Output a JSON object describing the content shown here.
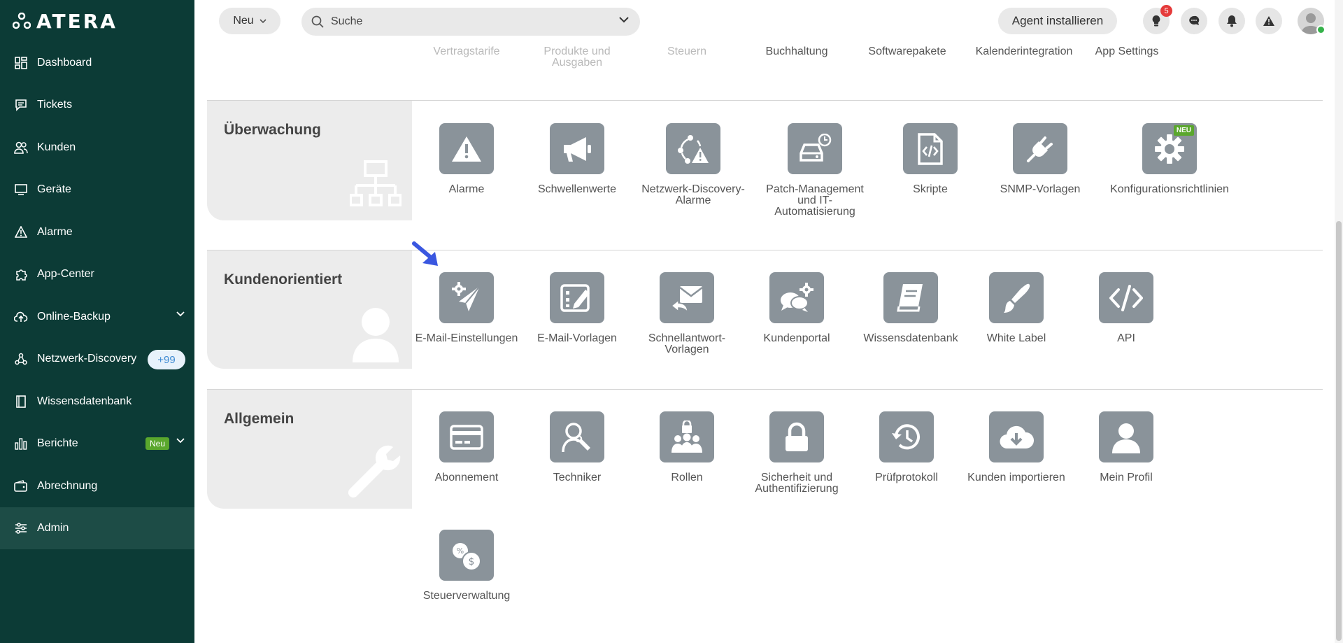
{
  "brand": {
    "logo_text": "ATERA"
  },
  "sidebar": {
    "items": [
      {
        "label": "Dashboard",
        "icon": "dashboard-icon"
      },
      {
        "label": "Tickets",
        "icon": "ticket-icon"
      },
      {
        "label": "Kunden",
        "icon": "users-icon"
      },
      {
        "label": "Geräte",
        "icon": "monitor-icon"
      },
      {
        "label": "Alarme",
        "icon": "warning-icon"
      },
      {
        "label": "App-Center",
        "icon": "puzzle-icon"
      },
      {
        "label": "Online-Backup",
        "icon": "cloud-upload-icon"
      },
      {
        "label": "Netzwerk-Discovery",
        "icon": "network-icon",
        "badge": "+99"
      },
      {
        "label": "Wissensdatenbank",
        "icon": "book-icon"
      },
      {
        "label": "Berichte",
        "icon": "bar-chart-icon",
        "badge": "Neu"
      },
      {
        "label": "Abrechnung",
        "icon": "wallet-icon"
      },
      {
        "label": "Admin",
        "icon": "sliders-icon",
        "active": true
      }
    ]
  },
  "topbar": {
    "new_button": "Neu",
    "search_placeholder": "Suche",
    "agent_button": "Agent installieren",
    "notification_count": "5"
  },
  "top_row": [
    {
      "label": "Vertragstarife",
      "faded": true
    },
    {
      "label": "Produkte und Ausgaben",
      "faded": true
    },
    {
      "label": "Steuern",
      "faded": true
    },
    {
      "label": "Buchhaltung",
      "faded": false
    },
    {
      "label": "Softwarepakete",
      "faded": false
    },
    {
      "label": "Kalenderintegration",
      "faded": false
    },
    {
      "label": "App Settings",
      "faded": false
    }
  ],
  "sections": {
    "monitoring": {
      "title": "Überwachung",
      "tiles": [
        {
          "label": "Alarme",
          "icon": "warning-icon"
        },
        {
          "label": "Schwellenwerte",
          "icon": "megaphone-icon"
        },
        {
          "label": "Netzwerk-Discovery-Alarme",
          "icon": "network-alert-icon"
        },
        {
          "label": "Patch-Management und IT-Automatisierung",
          "icon": "patch-clock-icon"
        },
        {
          "label": "Skripte",
          "icon": "script-file-icon"
        },
        {
          "label": "SNMP-Vorlagen",
          "icon": "plug-icon"
        },
        {
          "label": "Konfigurationsrichtlinien",
          "icon": "gear-icon",
          "tag": "NEU"
        }
      ]
    },
    "customer": {
      "title": "Kundenorientiert",
      "tiles": [
        {
          "label": "E-Mail-Einstellungen",
          "icon": "send-gear-icon"
        },
        {
          "label": "E-Mail-Vorlagen",
          "icon": "template-edit-icon"
        },
        {
          "label": "Schnellantwort-Vorlagen",
          "icon": "reply-mail-icon"
        },
        {
          "label": "Kundenportal",
          "icon": "chat-gear-icon"
        },
        {
          "label": "Wissensdatenbank",
          "icon": "book-icon"
        },
        {
          "label": "White Label",
          "icon": "brush-icon"
        },
        {
          "label": "API",
          "icon": "code-icon"
        }
      ]
    },
    "general": {
      "title": "Allgemein",
      "tiles": [
        {
          "label": "Abonnement",
          "icon": "credit-card-icon"
        },
        {
          "label": "Techniker",
          "icon": "technician-icon"
        },
        {
          "label": "Rollen",
          "icon": "roles-icon"
        },
        {
          "label": "Sicherheit und Authentifizierung",
          "icon": "lock-icon"
        },
        {
          "label": "Prüfprotokoll",
          "icon": "history-icon"
        },
        {
          "label": "Kunden importieren",
          "icon": "cloud-download-icon"
        },
        {
          "label": "Mein Profil",
          "icon": "profile-icon"
        },
        {
          "label": "Steuerverwaltung",
          "icon": "tax-icon"
        }
      ]
    }
  },
  "colors": {
    "sidebar_bg": "#0c3b36",
    "sidebar_active": "#1d4c46",
    "tile_bg": "#8a939a",
    "section_bg": "#ececec",
    "accent_new": "#5aa72d",
    "pointer_arrow": "#3a57e0"
  }
}
